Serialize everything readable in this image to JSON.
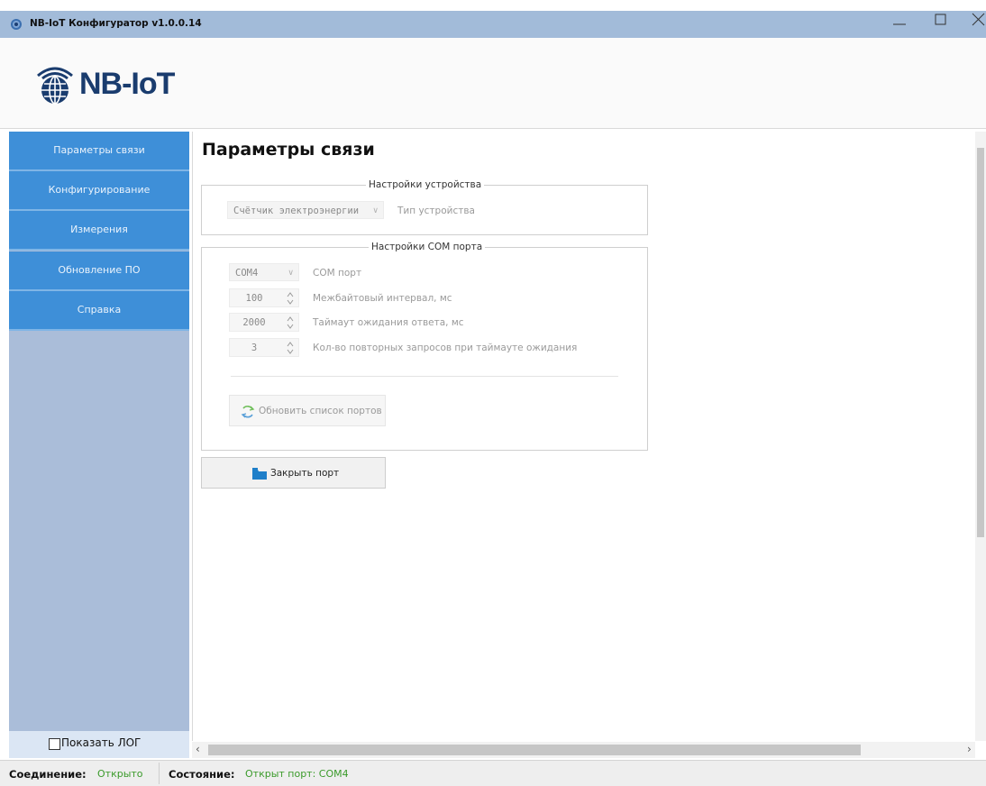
{
  "window": {
    "title": "NB-IoT Конфигуратор v1.0.0.14"
  },
  "header": {
    "logo_text": "NB-IoT"
  },
  "sidebar": {
    "items": [
      {
        "label": "Параметры связи"
      },
      {
        "label": "Конфигурирование"
      },
      {
        "label": "Измерения"
      },
      {
        "label": "Обновление ПО"
      },
      {
        "label": "Справка"
      }
    ],
    "show_log_label": "Показать ЛОГ"
  },
  "main": {
    "title": "Параметры связи",
    "device_group": {
      "legend": "Настройки устройства",
      "device_type_value": "Счётчик электроэнергии",
      "device_type_label": "Тип устройства"
    },
    "com_group": {
      "legend": "Настройки COM порта",
      "port_value": "COM4",
      "port_label": "COM порт",
      "interbyte_value": "100",
      "interbyte_label": "Межбайтовый интервал, мс",
      "timeout_value": "2000",
      "timeout_label": "Таймаут ожидания ответа, мс",
      "retries_value": "3",
      "retries_label": "Кол-во повторных запросов при таймауте ожидания",
      "refresh_button": "Обновить список портов"
    },
    "close_port_button": "Закрыть порт"
  },
  "statusbar": {
    "connection_key": "Соединение:",
    "connection_value": "Открыто",
    "state_key": "Состояние:",
    "state_value": "Открыт порт: COM4"
  },
  "colors": {
    "titlebar": "#a2bbd9",
    "nav_item": "#3e8fd8",
    "sidebar_bg": "#aabdd9",
    "status_ok": "#3a9a2a"
  }
}
